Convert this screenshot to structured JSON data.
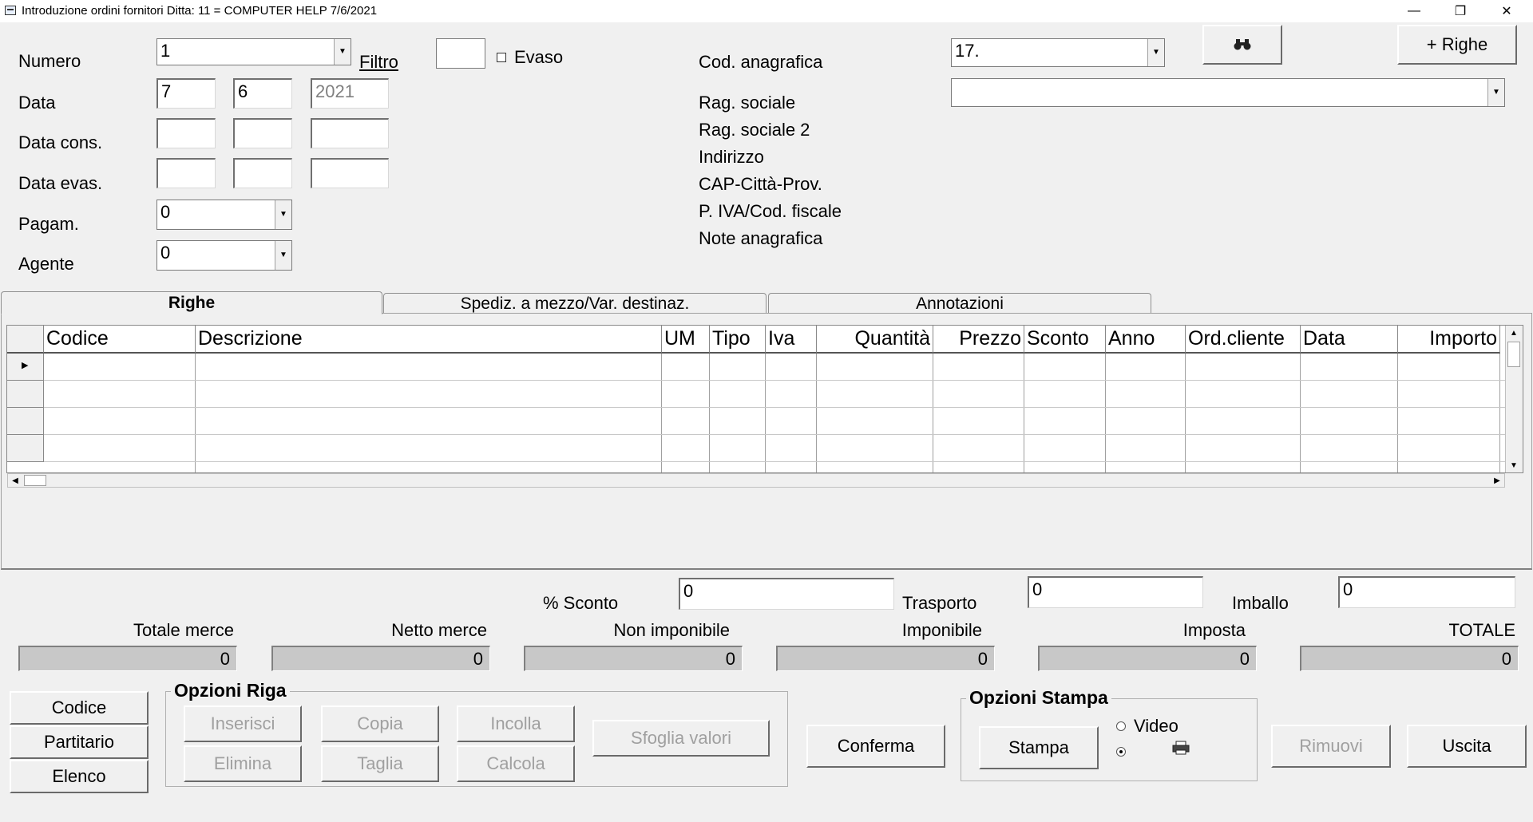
{
  "window": {
    "title": "Introduzione ordini fornitori  Ditta: 11 = COMPUTER HELP  7/6/2021",
    "minimize": "—",
    "restore": "❐",
    "close": "✕"
  },
  "header": {
    "numero_label": "Numero",
    "numero_value": "1",
    "filtro_label": "Filtro",
    "filtro_value": "",
    "evaso_label": "Evaso",
    "data_label": "Data",
    "data_day": "7",
    "data_month": "6",
    "data_year": "2021",
    "data_cons_label": "Data cons.",
    "data_evas_label": "Data evas.",
    "pagam_label": "Pagam.",
    "pagam_value": "0",
    "agente_label": "Agente",
    "agente_value": "0",
    "cod_anagrafica_label": "Cod. anagrafica",
    "cod_anagrafica_value": "17.",
    "rag_sociale_label": "Rag. sociale",
    "rag_sociale_value": "",
    "rag_sociale2_label": "Rag. sociale 2",
    "indirizzo_label": "Indirizzo",
    "cap_label": "CAP-Città-Prov.",
    "piva_label": "P. IVA/Cod. fiscale",
    "note_label": "Note anagrafica",
    "search_icon": "binoculars-icon",
    "righe_button": "+ Righe"
  },
  "tabs": [
    {
      "label": "Righe",
      "active": true
    },
    {
      "label": "Spediz. a mezzo/Var. destinaz.",
      "active": false
    },
    {
      "label": "Annotazioni",
      "active": false
    }
  ],
  "grid": {
    "columns": [
      "Codice",
      "Descrizione",
      "UM",
      "Tipo",
      "Iva",
      "Quantità",
      "Prezzo",
      "Sconto",
      "Anno",
      "Ord.cliente",
      "Data",
      "Importo"
    ],
    "rows": [
      [
        "",
        "",
        "",
        "",
        "",
        "",
        "",
        "",
        "",
        "",
        "",
        ""
      ],
      [
        "",
        "",
        "",
        "",
        "",
        "",
        "",
        "",
        "",
        "",
        "",
        ""
      ],
      [
        "",
        "",
        "",
        "",
        "",
        "",
        "",
        "",
        "",
        "",
        "",
        ""
      ],
      [
        "",
        "",
        "",
        "",
        "",
        "",
        "",
        "",
        "",
        "",
        "",
        ""
      ]
    ]
  },
  "footer": {
    "sconto_label": "% Sconto",
    "sconto_value": "0",
    "trasporto_label": "Trasporto",
    "trasporto_value": "0",
    "imballo_label": "Imballo",
    "imballo_value": "0",
    "totals": [
      {
        "label": "Totale merce",
        "value": "0"
      },
      {
        "label": "Netto merce",
        "value": "0"
      },
      {
        "label": "Non imponibile",
        "value": "0"
      },
      {
        "label": "Imponibile",
        "value": "0"
      },
      {
        "label": "Imposta",
        "value": "0"
      },
      {
        "label": "TOTALE",
        "value": "0"
      }
    ]
  },
  "buttons": {
    "codice": "Codice",
    "partitario": "Partitario",
    "elenco": "Elenco",
    "opzioni_riga": "Opzioni Riga",
    "inserisci": "Inserisci",
    "copia": "Copia",
    "incolla": "Incolla",
    "elimina": "Elimina",
    "taglia": "Taglia",
    "calcola": "Calcola",
    "sfoglia": "Sfoglia valori",
    "conferma": "Conferma",
    "opzioni_stampa": "Opzioni Stampa",
    "stampa": "Stampa",
    "video": "Video",
    "printer_icon": "printer-icon",
    "rimuovi": "Rimuovi",
    "uscita": "Uscita"
  }
}
